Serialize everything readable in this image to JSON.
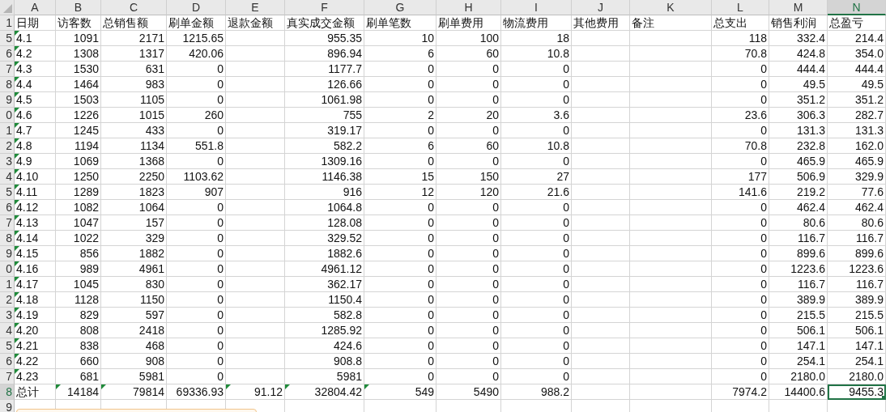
{
  "columns": [
    {
      "letter": "A",
      "selected": false
    },
    {
      "letter": "B",
      "selected": false
    },
    {
      "letter": "C",
      "selected": false
    },
    {
      "letter": "D",
      "selected": false
    },
    {
      "letter": "E",
      "selected": false
    },
    {
      "letter": "F",
      "selected": false
    },
    {
      "letter": "G",
      "selected": false
    },
    {
      "letter": "H",
      "selected": false
    },
    {
      "letter": "I",
      "selected": false
    },
    {
      "letter": "J",
      "selected": false
    },
    {
      "letter": "K",
      "selected": false
    },
    {
      "letter": "L",
      "selected": false
    },
    {
      "letter": "M",
      "selected": false
    },
    {
      "letter": "N",
      "selected": true
    }
  ],
  "rows": [
    {
      "header": "1",
      "kind": "header",
      "selected": false,
      "cells": [
        "日期",
        "访客数",
        "总销售额",
        "刷单金额",
        "退款金额",
        "真实成交金额",
        "刷单笔数",
        "刷单费用",
        "物流费用",
        "其他费用",
        "备注",
        "总支出",
        "销售利润",
        "总盈亏"
      ],
      "flagged": [
        false,
        false,
        false,
        false,
        false,
        false,
        false,
        false,
        false,
        false,
        false,
        false,
        false,
        false
      ]
    },
    {
      "header": "5",
      "kind": "data",
      "selected": false,
      "cells": [
        "4.1",
        "1091",
        "2171",
        "1215.65",
        null,
        "955.35",
        "10",
        "100",
        "18",
        null,
        null,
        "118",
        "332.4",
        "214.4"
      ],
      "flagged": [
        true,
        false,
        false,
        false,
        false,
        false,
        false,
        false,
        false,
        false,
        false,
        false,
        false,
        false
      ]
    },
    {
      "header": "6",
      "kind": "data",
      "selected": false,
      "cells": [
        "4.2",
        "1308",
        "1317",
        "420.06",
        null,
        "896.94",
        "6",
        "60",
        "10.8",
        null,
        null,
        "70.8",
        "424.8",
        "354.0"
      ],
      "flagged": [
        true,
        false,
        false,
        false,
        false,
        false,
        false,
        false,
        false,
        false,
        false,
        false,
        false,
        false
      ]
    },
    {
      "header": "7",
      "kind": "data",
      "selected": false,
      "cells": [
        "4.3",
        "1530",
        "631",
        "0",
        null,
        "1177.7",
        "0",
        "0",
        "0",
        null,
        null,
        "0",
        "444.4",
        "444.4"
      ],
      "flagged": [
        true,
        false,
        false,
        false,
        false,
        false,
        false,
        false,
        false,
        false,
        false,
        false,
        false,
        false
      ]
    },
    {
      "header": "8",
      "kind": "data",
      "selected": false,
      "cells": [
        "4.4",
        "1464",
        "983",
        "0",
        null,
        "126.66",
        "0",
        "0",
        "0",
        null,
        null,
        "0",
        "49.5",
        "49.5"
      ],
      "flagged": [
        true,
        false,
        false,
        false,
        false,
        false,
        false,
        false,
        false,
        false,
        false,
        false,
        false,
        false
      ]
    },
    {
      "header": "9",
      "kind": "data",
      "selected": false,
      "cells": [
        "4.5",
        "1503",
        "1105",
        "0",
        null,
        "1061.98",
        "0",
        "0",
        "0",
        null,
        null,
        "0",
        "351.2",
        "351.2"
      ],
      "flagged": [
        true,
        false,
        false,
        false,
        false,
        false,
        false,
        false,
        false,
        false,
        false,
        false,
        false,
        false
      ]
    },
    {
      "header": "0",
      "kind": "data",
      "selected": false,
      "cells": [
        "4.6",
        "1226",
        "1015",
        "260",
        null,
        "755",
        "2",
        "20",
        "3.6",
        null,
        null,
        "23.6",
        "306.3",
        "282.7"
      ],
      "flagged": [
        true,
        false,
        false,
        false,
        false,
        false,
        false,
        false,
        false,
        false,
        false,
        false,
        false,
        false
      ]
    },
    {
      "header": "1",
      "kind": "data",
      "selected": false,
      "cells": [
        "4.7",
        "1245",
        "433",
        "0",
        null,
        "319.17",
        "0",
        "0",
        "0",
        null,
        null,
        "0",
        "131.3",
        "131.3"
      ],
      "flagged": [
        true,
        false,
        false,
        false,
        false,
        false,
        false,
        false,
        false,
        false,
        false,
        false,
        false,
        false
      ]
    },
    {
      "header": "2",
      "kind": "data",
      "selected": false,
      "cells": [
        "4.8",
        "1194",
        "1134",
        "551.8",
        null,
        "582.2",
        "6",
        "60",
        "10.8",
        null,
        null,
        "70.8",
        "232.8",
        "162.0"
      ],
      "flagged": [
        true,
        false,
        false,
        false,
        false,
        false,
        false,
        false,
        false,
        false,
        false,
        false,
        false,
        false
      ]
    },
    {
      "header": "3",
      "kind": "data",
      "selected": false,
      "cells": [
        "4.9",
        "1069",
        "1368",
        "0",
        null,
        "1309.16",
        "0",
        "0",
        "0",
        null,
        null,
        "0",
        "465.9",
        "465.9"
      ],
      "flagged": [
        true,
        false,
        false,
        false,
        false,
        false,
        false,
        false,
        false,
        false,
        false,
        false,
        false,
        false
      ]
    },
    {
      "header": "4",
      "kind": "data",
      "selected": false,
      "cells": [
        "4.10",
        "1250",
        "2250",
        "1103.62",
        null,
        "1146.38",
        "15",
        "150",
        "27",
        null,
        null,
        "177",
        "506.9",
        "329.9"
      ],
      "flagged": [
        true,
        false,
        false,
        false,
        false,
        false,
        false,
        false,
        false,
        false,
        false,
        false,
        false,
        false
      ]
    },
    {
      "header": "5",
      "kind": "data",
      "selected": false,
      "cells": [
        "4.11",
        "1289",
        "1823",
        "907",
        null,
        "916",
        "12",
        "120",
        "21.6",
        null,
        null,
        "141.6",
        "219.2",
        "77.6"
      ],
      "flagged": [
        true,
        false,
        false,
        false,
        false,
        false,
        false,
        false,
        false,
        false,
        false,
        false,
        false,
        false
      ]
    },
    {
      "header": "6",
      "kind": "data",
      "selected": false,
      "cells": [
        "4.12",
        "1082",
        "1064",
        "0",
        null,
        "1064.8",
        "0",
        "0",
        "0",
        null,
        null,
        "0",
        "462.4",
        "462.4"
      ],
      "flagged": [
        true,
        false,
        false,
        false,
        false,
        false,
        false,
        false,
        false,
        false,
        false,
        false,
        false,
        false
      ]
    },
    {
      "header": "7",
      "kind": "data",
      "selected": false,
      "cells": [
        "4.13",
        "1047",
        "157",
        "0",
        null,
        "128.08",
        "0",
        "0",
        "0",
        null,
        null,
        "0",
        "80.6",
        "80.6"
      ],
      "flagged": [
        true,
        false,
        false,
        false,
        false,
        false,
        false,
        false,
        false,
        false,
        false,
        false,
        false,
        false
      ]
    },
    {
      "header": "8",
      "kind": "data",
      "selected": false,
      "cells": [
        "4.14",
        "1022",
        "329",
        "0",
        null,
        "329.52",
        "0",
        "0",
        "0",
        null,
        null,
        "0",
        "116.7",
        "116.7"
      ],
      "flagged": [
        true,
        false,
        false,
        false,
        false,
        false,
        false,
        false,
        false,
        false,
        false,
        false,
        false,
        false
      ]
    },
    {
      "header": "9",
      "kind": "data",
      "selected": false,
      "cells": [
        "4.15",
        "856",
        "1882",
        "0",
        null,
        "1882.6",
        "0",
        "0",
        "0",
        null,
        null,
        "0",
        "899.6",
        "899.6"
      ],
      "flagged": [
        true,
        false,
        false,
        false,
        false,
        false,
        false,
        false,
        false,
        false,
        false,
        false,
        false,
        false
      ]
    },
    {
      "header": "0",
      "kind": "data",
      "selected": false,
      "cells": [
        "4.16",
        "989",
        "4961",
        "0",
        null,
        "4961.12",
        "0",
        "0",
        "0",
        null,
        null,
        "0",
        "1223.6",
        "1223.6"
      ],
      "flagged": [
        true,
        false,
        false,
        false,
        false,
        false,
        false,
        false,
        false,
        false,
        false,
        false,
        false,
        false
      ]
    },
    {
      "header": "1",
      "kind": "data",
      "selected": false,
      "cells": [
        "4.17",
        "1045",
        "830",
        "0",
        null,
        "362.17",
        "0",
        "0",
        "0",
        null,
        null,
        "0",
        "116.7",
        "116.7"
      ],
      "flagged": [
        true,
        false,
        false,
        false,
        false,
        false,
        false,
        false,
        false,
        false,
        false,
        false,
        false,
        false
      ]
    },
    {
      "header": "2",
      "kind": "data",
      "selected": false,
      "cells": [
        "4.18",
        "1128",
        "1150",
        "0",
        null,
        "1150.4",
        "0",
        "0",
        "0",
        null,
        null,
        "0",
        "389.9",
        "389.9"
      ],
      "flagged": [
        true,
        false,
        false,
        false,
        false,
        false,
        false,
        false,
        false,
        false,
        false,
        false,
        false,
        false
      ]
    },
    {
      "header": "3",
      "kind": "data",
      "selected": false,
      "cells": [
        "4.19",
        "829",
        "597",
        "0",
        null,
        "582.8",
        "0",
        "0",
        "0",
        null,
        null,
        "0",
        "215.5",
        "215.5"
      ],
      "flagged": [
        true,
        false,
        false,
        false,
        false,
        false,
        false,
        false,
        false,
        false,
        false,
        false,
        false,
        false
      ]
    },
    {
      "header": "4",
      "kind": "data",
      "selected": false,
      "cells": [
        "4.20",
        "808",
        "2418",
        "0",
        null,
        "1285.92",
        "0",
        "0",
        "0",
        null,
        null,
        "0",
        "506.1",
        "506.1"
      ],
      "flagged": [
        true,
        false,
        false,
        false,
        false,
        false,
        false,
        false,
        false,
        false,
        false,
        false,
        false,
        false
      ]
    },
    {
      "header": "5",
      "kind": "data",
      "selected": false,
      "cells": [
        "4.21",
        "838",
        "468",
        "0",
        null,
        "424.6",
        "0",
        "0",
        "0",
        null,
        null,
        "0",
        "147.1",
        "147.1"
      ],
      "flagged": [
        true,
        false,
        false,
        false,
        false,
        false,
        false,
        false,
        false,
        false,
        false,
        false,
        false,
        false
      ]
    },
    {
      "header": "6",
      "kind": "data",
      "selected": false,
      "cells": [
        "4.22",
        "660",
        "908",
        "0",
        null,
        "908.8",
        "0",
        "0",
        "0",
        null,
        null,
        "0",
        "254.1",
        "254.1"
      ],
      "flagged": [
        true,
        false,
        false,
        false,
        false,
        false,
        false,
        false,
        false,
        false,
        false,
        false,
        false,
        false
      ]
    },
    {
      "header": "7",
      "kind": "data",
      "selected": false,
      "cells": [
        "4.23",
        "681",
        "5981",
        "0",
        null,
        "5981",
        "0",
        "0",
        "0",
        null,
        null,
        "0",
        "2180.0",
        "2180.0"
      ],
      "flagged": [
        true,
        false,
        false,
        false,
        false,
        false,
        false,
        false,
        false,
        false,
        false,
        false,
        false,
        false
      ]
    },
    {
      "header": "8",
      "kind": "data",
      "selected": true,
      "cells": [
        "总计",
        "14184",
        "79814",
        "69336.93",
        "91.12",
        "32804.42",
        "549",
        "5490",
        "988.2",
        null,
        null,
        "7974.2",
        "14400.6",
        "9455.3"
      ],
      "flagged": [
        false,
        true,
        true,
        false,
        true,
        true,
        true,
        false,
        false,
        false,
        false,
        false,
        false,
        false
      ]
    },
    {
      "header": "9",
      "kind": "data",
      "selected": false,
      "cells": [
        null,
        null,
        null,
        null,
        null,
        null,
        null,
        null,
        null,
        null,
        null,
        null,
        null,
        null
      ],
      "flagged": [
        false,
        false,
        false,
        false,
        false,
        false,
        false,
        false,
        false,
        false,
        false,
        false,
        false,
        false
      ]
    }
  ]
}
